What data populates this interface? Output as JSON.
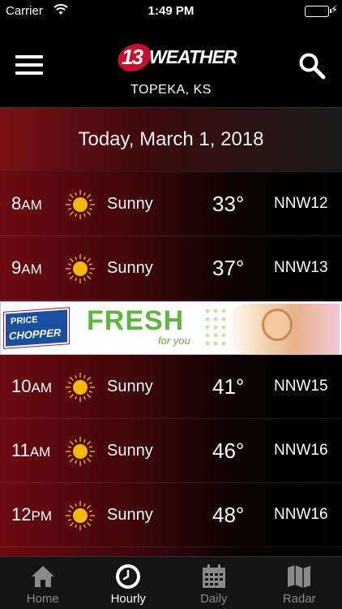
{
  "status_bar": {
    "carrier": "Carrier",
    "time": "1:49 PM",
    "battery": 1.0
  },
  "header": {
    "logo_number": "13",
    "logo_word": "WEATHER",
    "location": "TOPEKA, KS"
  },
  "date_label": "Today, March 1, 2018",
  "hourly": [
    {
      "hour": "8",
      "ampm": "AM",
      "condition": "Sunny",
      "temp": "33°",
      "wind": "NNW12",
      "icon": "sun-icon"
    },
    {
      "hour": "9",
      "ampm": "AM",
      "condition": "Sunny",
      "temp": "37°",
      "wind": "NNW13",
      "icon": "sun-icon"
    },
    {
      "hour": "10",
      "ampm": "AM",
      "condition": "Sunny",
      "temp": "41°",
      "wind": "NNW15",
      "icon": "sun-icon"
    },
    {
      "hour": "11",
      "ampm": "AM",
      "condition": "Sunny",
      "temp": "46°",
      "wind": "NNW16",
      "icon": "sun-icon"
    },
    {
      "hour": "12",
      "ampm": "PM",
      "condition": "Sunny",
      "temp": "48°",
      "wind": "NNW16",
      "icon": "sun-icon"
    }
  ],
  "ad": {
    "brand_line1": "PRICE",
    "brand_line2": "CHOPPER",
    "headline": "FRESH",
    "tagline": "for you"
  },
  "tabs": [
    {
      "label": "Home",
      "icon": "home-icon",
      "active": false
    },
    {
      "label": "Hourly",
      "icon": "clock-icon",
      "active": true
    },
    {
      "label": "Daily",
      "icon": "calendar-icon",
      "active": false
    },
    {
      "label": "Radar",
      "icon": "map-icon",
      "active": false
    }
  ],
  "colors": {
    "accent_red": "#c8102e",
    "sun": "#f5b800",
    "battery": "#4cd964",
    "fresh_green": "#5cb83c"
  }
}
